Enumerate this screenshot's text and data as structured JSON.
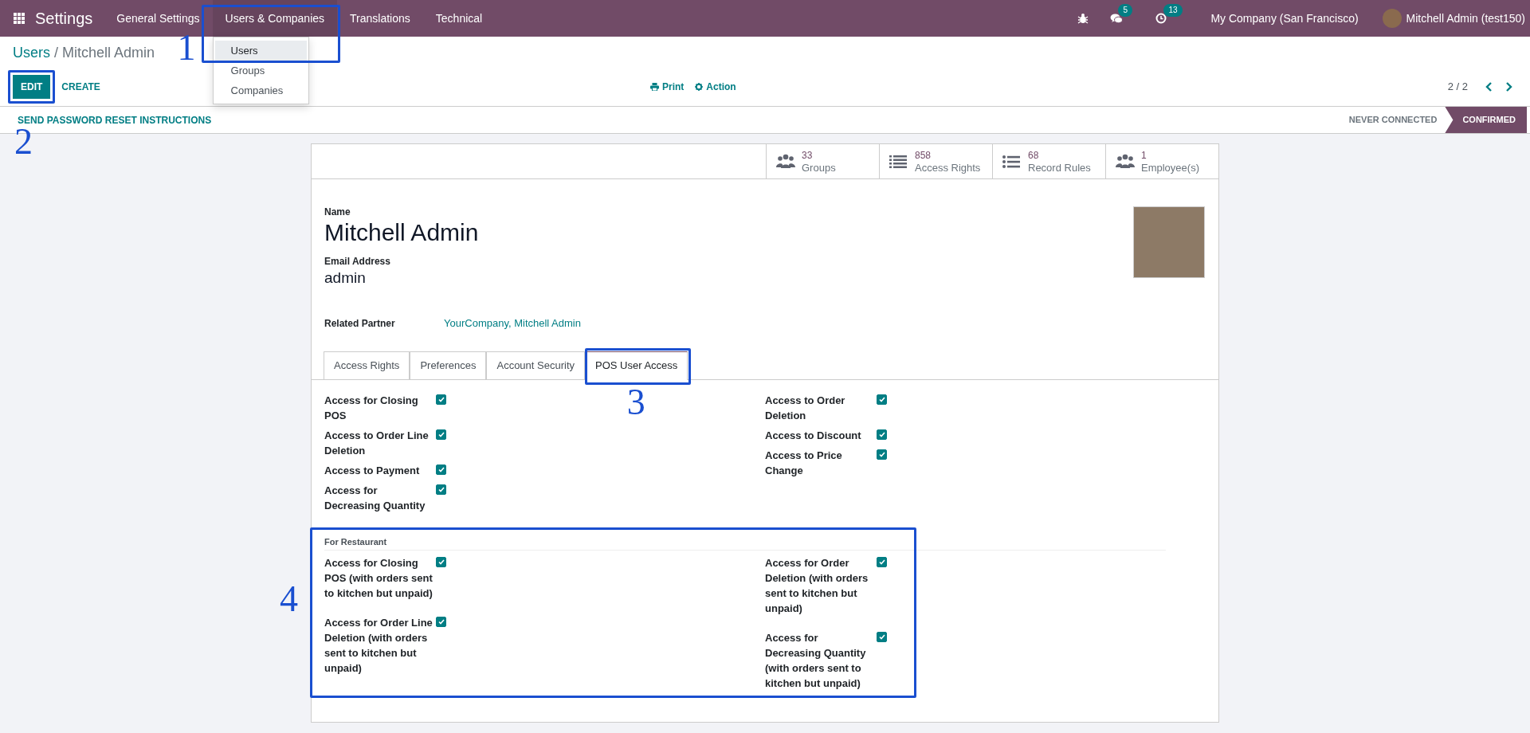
{
  "navbar": {
    "app_title": "Settings",
    "menus": [
      {
        "label": "General Settings",
        "selected": false
      },
      {
        "label": "Users & Companies",
        "selected": true
      },
      {
        "label": "Translations",
        "selected": false
      },
      {
        "label": "Technical",
        "selected": false
      }
    ],
    "messages_badge": "5",
    "activities_badge": "13",
    "company": "My Company (San Francisco)",
    "user": "Mitchell Admin (test150)"
  },
  "dropdown": {
    "items": [
      {
        "label": "Users",
        "selected": true
      },
      {
        "label": "Groups",
        "selected": false
      },
      {
        "label": "Companies",
        "selected": false
      }
    ]
  },
  "breadcrumb": {
    "parent": "Users",
    "separator": "/",
    "current": "Mitchell Admin"
  },
  "control_panel": {
    "buttons": [
      {
        "label": "EDIT",
        "kind": "primary"
      },
      {
        "label": "CREATE",
        "kind": "link"
      }
    ],
    "actions": [
      {
        "label": "Print",
        "kind": "print"
      },
      {
        "label": "Action",
        "kind": "gear"
      }
    ],
    "pager": "2 / 2"
  },
  "status_bar": {
    "button": "SEND PASSWORD RESET INSTRUCTIONS",
    "stages": [
      {
        "label": "NEVER CONNECTED",
        "selected": false
      },
      {
        "label": "CONFIRMED",
        "selected": true
      }
    ]
  },
  "smart_buttons": [
    {
      "value": "33",
      "label": "Groups",
      "kind": "users"
    },
    {
      "value": "858",
      "label": "Access Rights",
      "kind": "list"
    },
    {
      "value": "68",
      "label": "Record Rules",
      "kind": "bullets"
    },
    {
      "value": "1",
      "label": "Employee(s)",
      "kind": "users"
    }
  ],
  "form": {
    "name_label": "Name",
    "name": "Mitchell Admin",
    "email_label": "Email Address",
    "email": "admin",
    "partner_label": "Related Partner",
    "partner": "YourCompany, Mitchell Admin"
  },
  "tabs": [
    {
      "label": "Access Rights",
      "selected": false
    },
    {
      "label": "Preferences",
      "selected": false
    },
    {
      "label": "Account Security",
      "selected": false
    },
    {
      "label": "POS User Access",
      "selected": true
    }
  ],
  "permissions": {
    "left": [
      {
        "label": "Access for Closing POS",
        "checked": true
      },
      {
        "label": "Access to Order Line Deletion",
        "checked": true
      },
      {
        "label": "Access to Payment",
        "checked": true
      },
      {
        "label": "Access for Decreasing Quantity",
        "checked": true
      }
    ],
    "right": [
      {
        "label": "Access to Order Deletion",
        "checked": true
      },
      {
        "label": "Access to Discount",
        "checked": true
      },
      {
        "label": "Access to Price Change",
        "checked": true
      }
    ]
  },
  "restaurant": {
    "title": "For Restaurant",
    "left": [
      {
        "label": "Access for Closing POS (with orders sent to kitchen but unpaid)",
        "checked": true
      },
      {
        "label": "Access for Order Line Deletion (with orders sent to kitchen but unpaid)",
        "checked": true
      }
    ],
    "right": [
      {
        "label": "Access for Order Deletion (with orders sent to kitchen but unpaid)",
        "checked": true
      },
      {
        "label": "Access for Decreasing Quantity (with orders sent to kitchen but unpaid)",
        "checked": true
      }
    ]
  },
  "annotations": [
    {
      "number": "1"
    },
    {
      "number": "2"
    },
    {
      "number": "3"
    },
    {
      "number": "4"
    }
  ]
}
